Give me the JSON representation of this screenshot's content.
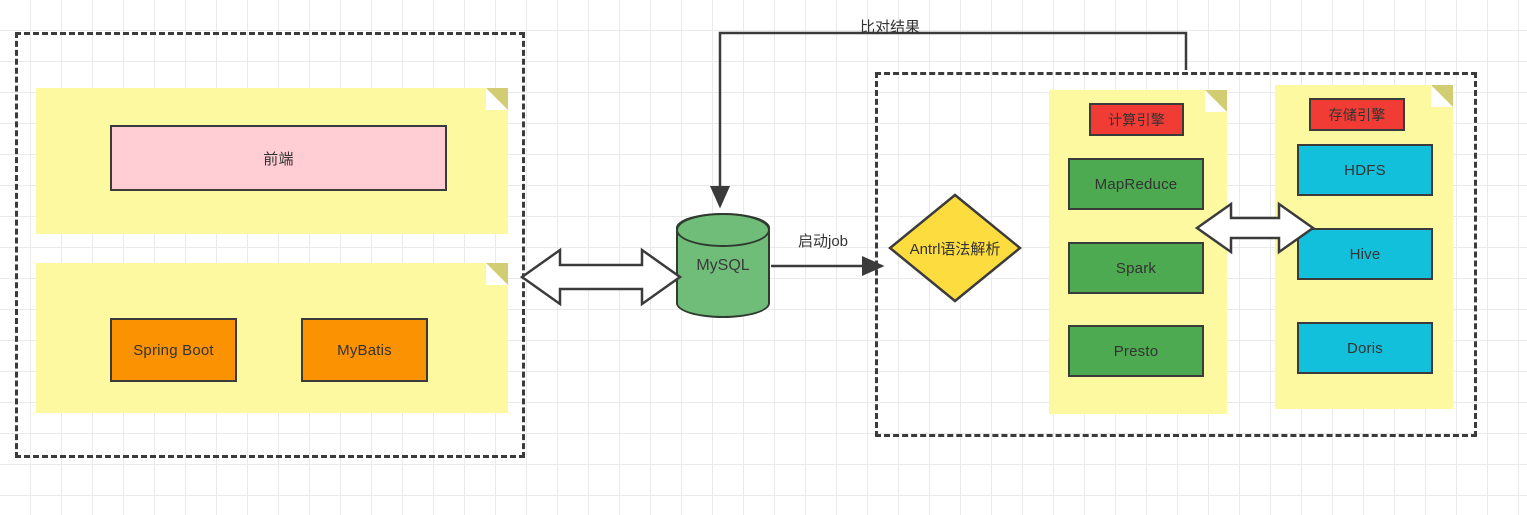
{
  "diagram": {
    "title": "big-data-platform-architecture",
    "colors": {
      "note_fill": "#FCF9A0",
      "note_fold": "#D2CD72",
      "pink": "#FFCDD3",
      "orange": "#FB9201",
      "green": "#4DAA50",
      "cyan": "#12C0DB",
      "red": "#F03C34",
      "cylinder": "#70BD79",
      "diamond": "#FCDC3E",
      "stroke": "#3B3B3B",
      "grid": "#EAEAEA"
    }
  },
  "left_group": {
    "name": "application-layer",
    "frontend_note": {
      "boxes": [
        {
          "label": "前端",
          "style": "pink"
        }
      ]
    },
    "backend_note": {
      "boxes": [
        {
          "label": "Spring Boot",
          "style": "orange"
        },
        {
          "label": "MyBatis",
          "style": "orange"
        }
      ]
    }
  },
  "database": {
    "label": "MySQL",
    "shape": "cylinder"
  },
  "parser": {
    "label": "Antrl语法解析",
    "shape": "diamond"
  },
  "right_group": {
    "name": "engine-layer",
    "compute_note": {
      "header": "计算引擎",
      "boxes": [
        {
          "label": "MapReduce",
          "style": "green"
        },
        {
          "label": "Spark",
          "style": "green"
        },
        {
          "label": "Presto",
          "style": "green"
        }
      ]
    },
    "storage_note": {
      "header": "存储引擎",
      "boxes": [
        {
          "label": "HDFS",
          "style": "cyan"
        },
        {
          "label": "Hive",
          "style": "cyan"
        },
        {
          "label": "Doris",
          "style": "cyan"
        }
      ]
    }
  },
  "connectors": {
    "feedback_label": "比对结果",
    "start_job_label": "启动job",
    "app_db_arrow": "bidirectional",
    "engine_storage_arrow": "bidirectional"
  }
}
